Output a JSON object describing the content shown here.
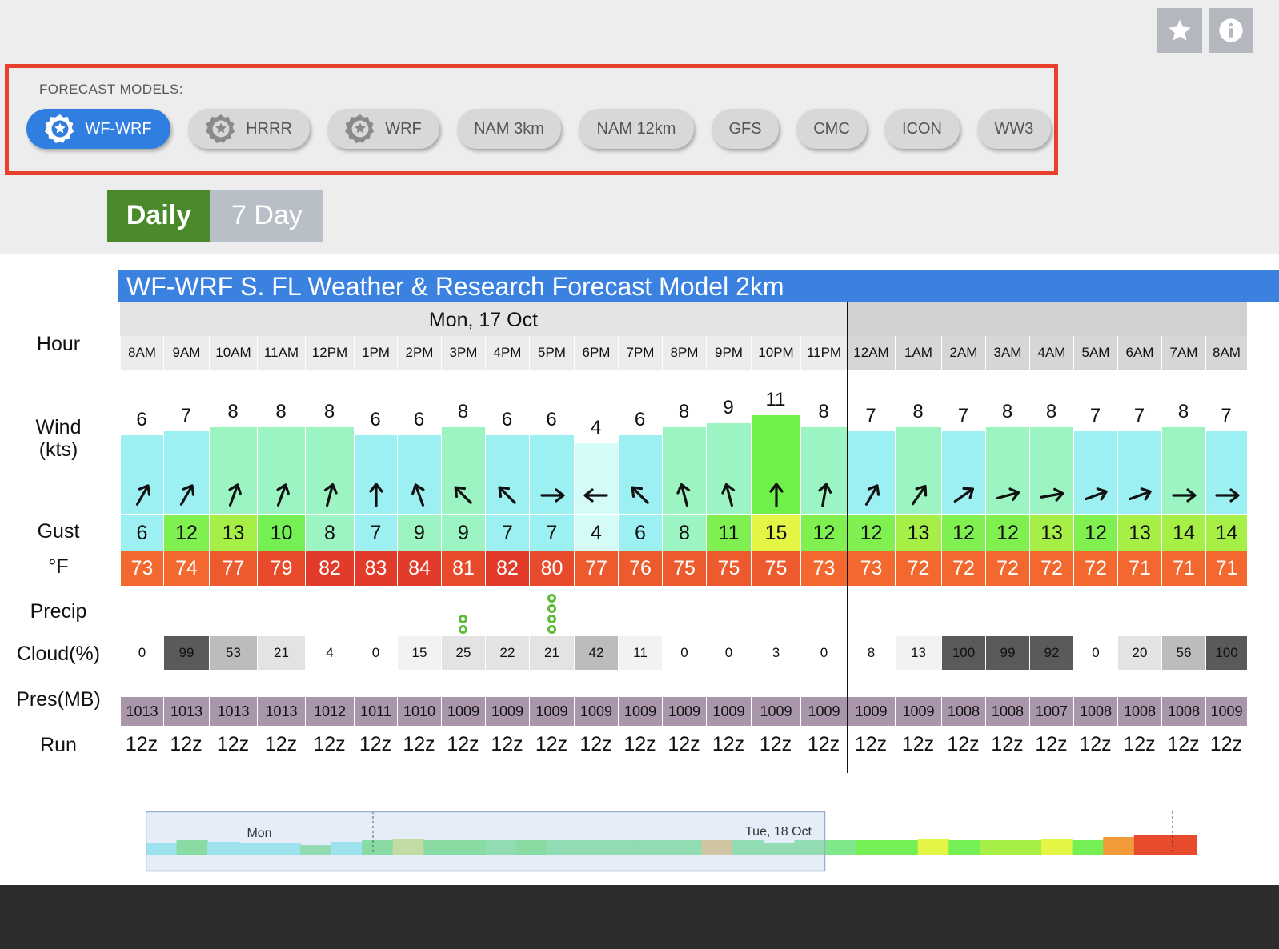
{
  "top_buttons": [
    {
      "icon": "star-icon"
    },
    {
      "icon": "info-icon"
    }
  ],
  "forecast_models": {
    "label": "FORECAST MODELS:",
    "items": [
      {
        "label": "WF-WRF",
        "active": true,
        "starred": true
      },
      {
        "label": "HRRR",
        "active": false,
        "starred": true
      },
      {
        "label": "WRF",
        "active": false,
        "starred": true
      },
      {
        "label": "NAM 3km",
        "active": false,
        "starred": false
      },
      {
        "label": "NAM 12km",
        "active": false,
        "starred": false
      },
      {
        "label": "GFS",
        "active": false,
        "starred": false
      },
      {
        "label": "CMC",
        "active": false,
        "starred": false
      },
      {
        "label": "ICON",
        "active": false,
        "starred": false
      },
      {
        "label": "WW3",
        "active": false,
        "starred": false
      }
    ]
  },
  "tabs": {
    "daily": "Daily",
    "seven_day": "7 Day",
    "selected": "daily"
  },
  "forecast": {
    "title": "WF-WRF S. FL Weather & Research Forecast Model 2km",
    "dates": [
      "Mon, 17 Oct",
      ""
    ],
    "row_labels": {
      "hour": "Hour",
      "wind": "Wind\n(kts)",
      "gust": "Gust",
      "temp": "°F",
      "precip": "Precip",
      "cloud": "Cloud(%)",
      "pres": "Pres(MB)",
      "run": "Run"
    },
    "hours": [
      "8AM",
      "9AM",
      "10AM",
      "11AM",
      "12PM",
      "1PM",
      "2PM",
      "3PM",
      "4PM",
      "5PM",
      "6PM",
      "7PM",
      "8PM",
      "9PM",
      "10PM",
      "11PM",
      "12AM",
      "1AM",
      "2AM",
      "3AM",
      "4AM",
      "5AM",
      "6AM",
      "7AM",
      "8AM"
    ],
    "wind": [
      "6",
      "7",
      "8",
      "8",
      "8",
      "6",
      "6",
      "8",
      "6",
      "6",
      "4",
      "6",
      "8",
      "9",
      "11",
      "8",
      "7",
      "8",
      "7",
      "8",
      "8",
      "7",
      "7",
      "8",
      "7"
    ],
    "wind_dir_deg": [
      210,
      210,
      200,
      200,
      195,
      180,
      160,
      135,
      135,
      270,
      90,
      135,
      165,
      165,
      180,
      190,
      210,
      215,
      235,
      255,
      260,
      250,
      250,
      270,
      270
    ],
    "gust": [
      "6",
      "12",
      "13",
      "10",
      "8",
      "7",
      "9",
      "9",
      "7",
      "7",
      "4",
      "6",
      "8",
      "11",
      "15",
      "12",
      "12",
      "13",
      "12",
      "12",
      "13",
      "12",
      "13",
      "14",
      "14"
    ],
    "temp": [
      "73",
      "74",
      "77",
      "79",
      "82",
      "83",
      "84",
      "81",
      "82",
      "80",
      "77",
      "76",
      "75",
      "75",
      "75",
      "73",
      "73",
      "72",
      "72",
      "72",
      "72",
      "72",
      "71",
      "71",
      "71"
    ],
    "precip_drops": [
      0,
      0,
      0,
      0,
      0,
      0,
      0,
      2,
      0,
      4,
      0,
      0,
      0,
      0,
      0,
      0,
      0,
      0,
      0,
      0,
      0,
      0,
      0,
      0,
      0
    ],
    "cloud": [
      "0",
      "99",
      "53",
      "21",
      "4",
      "0",
      "15",
      "25",
      "22",
      "21",
      "42",
      "11",
      "0",
      "0",
      "3",
      "0",
      "8",
      "13",
      "100",
      "99",
      "92",
      "0",
      "20",
      "56",
      "100"
    ],
    "pres": [
      "1013",
      "1013",
      "1013",
      "1013",
      "1012",
      "1011",
      "1010",
      "1009",
      "1009",
      "1009",
      "1009",
      "1009",
      "1009",
      "1009",
      "1009",
      "1009",
      "1009",
      "1009",
      "1008",
      "1008",
      "1007",
      "1008",
      "1008",
      "1008",
      "1009"
    ],
    "run": [
      "12z",
      "12z",
      "12z",
      "12z",
      "12z",
      "12z",
      "12z",
      "12z",
      "12z",
      "12z",
      "12z",
      "12z",
      "12z",
      "12z",
      "12z",
      "12z",
      "12z",
      "12z",
      "12z",
      "12z",
      "12z",
      "12z",
      "12z",
      "12z",
      "12z"
    ]
  },
  "timeline": {
    "label_mon": "Mon",
    "label_tue": "Tue, 18 Oct"
  },
  "colors": {
    "accent": "#3b82e0",
    "active_pill": "#2f7ee0",
    "highlight_border": "#e8402c",
    "daily_tab": "#4a8a2a"
  }
}
